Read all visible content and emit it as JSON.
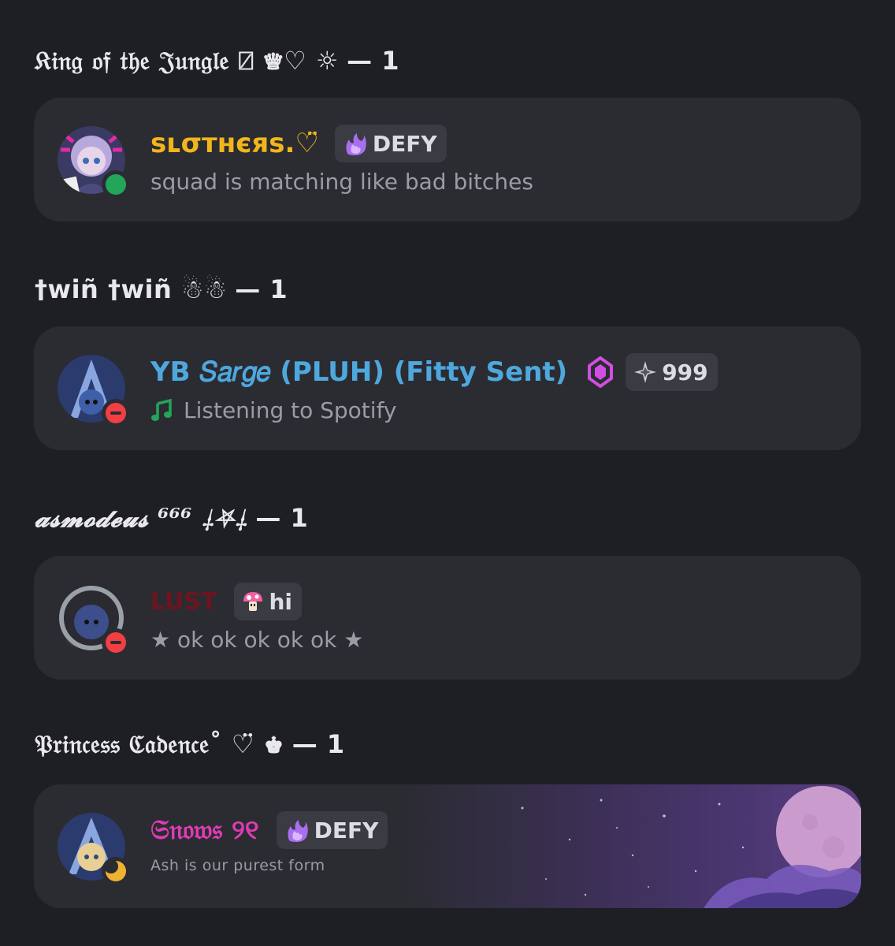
{
  "roles": [
    {
      "header": "𝔎𝔦𝔫𝔤 𝔬𝔣 𝔱𝔥𝔢 𝔍𝔲𝔫𝔤𝔩𝔢 ⍁ ♕♡ ☼",
      "count": "— 1",
      "member": {
        "username": "sʟσтнєяѕ.♡̈",
        "username_color": "#f2b51b",
        "tag_label": "DEFY",
        "tag_icon": "purple-flame-icon",
        "status_text": "squad is matching like bad bitches",
        "presence": "online",
        "presence_color": "#23a55a"
      }
    },
    {
      "header": "†wiñ †wiñ ☃☃",
      "count": "— 1",
      "member": {
        "username": "YB 𝑆𝑎𝑟𝑔𝑒 (PLUH) (Fitty Sent)",
        "username_color": "#4ea8de",
        "badge_icon": "purple-gem-icon",
        "tag_label": "999",
        "tag_icon": "sparkle-icon",
        "activity_icon": "music-note-icon",
        "status_text": "Listening to Spotify",
        "presence": "do-not-disturb",
        "presence_color": "#f23f43"
      }
    },
    {
      "header": "𝓪𝓼𝓶𝓸𝓭𝓮𝓾𝓼 ⁶⁶⁶ ⸸⛧⸸",
      "count": "— 1",
      "member": {
        "username": "LUST",
        "username_color": "#6e1420",
        "tag_label": "hi",
        "tag_icon": "mushroom-icon",
        "status_text": "★ ok ok ok ok ok ★",
        "presence": "do-not-disturb",
        "presence_color": "#f23f43"
      }
    },
    {
      "header": "𝔓𝔯𝔦𝔫𝔠𝔢𝔰𝔰 ℭ𝔞𝔡𝔢𝔫𝔠𝔢˚ ♡̈ ♚",
      "count": "— 1",
      "member": {
        "username": "𝔖𝔫𝔬𝔴𝔰 ୨୧",
        "username_color": "#e03bb5",
        "tag_label": "DEFY",
        "tag_icon": "purple-flame-icon",
        "status_text": "Ash is our purest form",
        "presence": "idle",
        "presence_color": "#f0b232"
      }
    }
  ]
}
